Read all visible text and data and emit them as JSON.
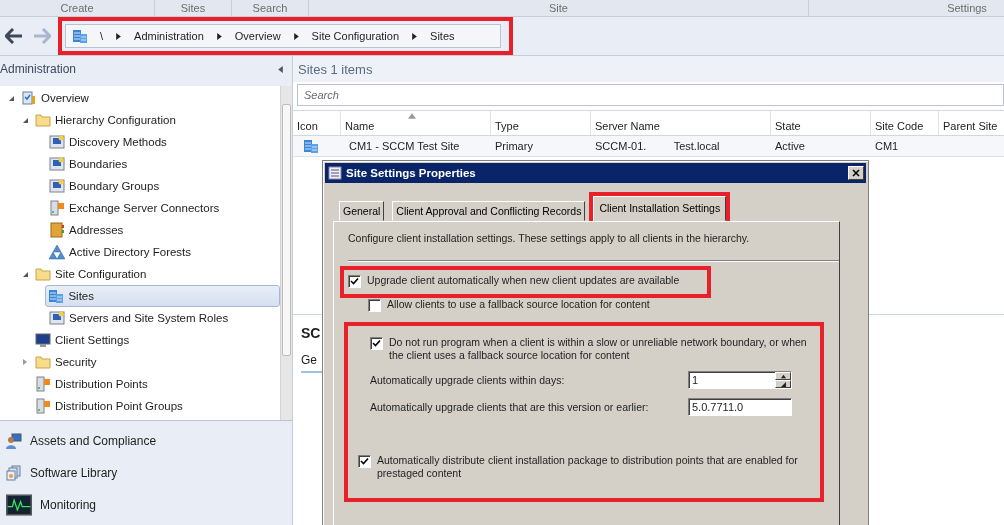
{
  "ribbon_groups": [
    "Create",
    "Sites",
    "Search",
    "Site",
    "Settings"
  ],
  "breadcrumb": {
    "highlighted": true,
    "items": [
      "\\",
      "Administration",
      "Overview",
      "Site Configuration",
      "Sites"
    ]
  },
  "navigation": {
    "title": "Administration",
    "tree": [
      {
        "label": "Overview",
        "kind": "overview",
        "expanded": true,
        "selected": false,
        "children": [
          {
            "label": "Hierarchy Configuration",
            "kind": "folder",
            "expanded": true,
            "selected": false,
            "children": [
              {
                "label": "Discovery Methods",
                "kind": "node",
                "selected": false
              },
              {
                "label": "Boundaries",
                "kind": "node",
                "selected": false
              },
              {
                "label": "Boundary Groups",
                "kind": "node",
                "selected": false
              },
              {
                "label": "Exchange Server Connectors",
                "kind": "server",
                "selected": false
              },
              {
                "label": "Addresses",
                "kind": "book",
                "selected": false
              },
              {
                "label": "Active Directory Forests",
                "kind": "forest",
                "selected": false
              }
            ]
          },
          {
            "label": "Site Configuration",
            "kind": "folder",
            "expanded": true,
            "selected": false,
            "children": [
              {
                "label": "Sites",
                "kind": "sites",
                "selected": true
              },
              {
                "label": "Servers and Site System Roles",
                "kind": "node",
                "selected": false
              }
            ]
          },
          {
            "label": "Client Settings",
            "kind": "monitor",
            "selected": false
          },
          {
            "label": "Security",
            "kind": "folder",
            "expanded": false,
            "selected": false
          },
          {
            "label": "Distribution Points",
            "kind": "server",
            "selected": false
          },
          {
            "label": "Distribution Point Groups",
            "kind": "server",
            "selected": false
          }
        ]
      }
    ],
    "workspaces": [
      {
        "label": "Assets and Compliance",
        "kind": "person"
      },
      {
        "label": "Software Library",
        "kind": "library"
      },
      {
        "label": "Monitoring",
        "kind": "monitor"
      }
    ]
  },
  "list": {
    "title": "Sites 1 items",
    "search": {
      "placeholder": "Search"
    },
    "columns": [
      {
        "label": "Icon",
        "sorted": false
      },
      {
        "label": "Name",
        "sorted": true
      },
      {
        "label": "Type",
        "sorted": false
      },
      {
        "label": "Server Name",
        "sorted": false
      },
      {
        "label": "State",
        "sorted": false
      },
      {
        "label": "Site Code",
        "sorted": false
      },
      {
        "label": "Parent Site",
        "sorted": false
      }
    ],
    "rows": [
      {
        "cells": [
          "",
          "CM1 - SCCM Test Site",
          "Primary",
          "SCCM-01.         Test.local",
          "Active",
          "CM1"
        ]
      }
    ]
  },
  "details": {
    "title": "SC",
    "tab": "Ge"
  },
  "dialog": {
    "title": "Site Settings Properties",
    "tabs": [
      {
        "label": "General",
        "selected": false,
        "highlighted": false
      },
      {
        "label": "Client Approval and Conflicting Records",
        "selected": false,
        "highlighted": false
      },
      {
        "label": "Client Installation Settings",
        "selected": true,
        "highlighted": true
      }
    ],
    "description": "Configure client installation settings.  These settings apply to all clients in the hierarchy.",
    "upgrade": {
      "label": "Upgrade client automatically when new client updates are available",
      "checked": true,
      "highlighted": true
    },
    "fallback": {
      "label": "Allow clients to use a fallback source location for content",
      "checked": false
    },
    "group": {
      "highlighted": true,
      "indented_items": [
        {
          "kind": "checkbox",
          "label": "Do not run program when a client is within a slow or unreliable network boundary, or when the client uses a fallback source location for content",
          "checked": true
        },
        {
          "kind": "spin",
          "label": "Automatically upgrade clients within days:",
          "value": "1"
        },
        {
          "kind": "text",
          "label": "Automatically upgrade clients that are this version or earlier:",
          "value": "5.0.7711.0"
        }
      ],
      "items": [
        {
          "kind": "checkbox",
          "label": "Automatically distribute client installation package to distribution points that are enabled for prestaged content",
          "checked": true
        }
      ]
    }
  }
}
